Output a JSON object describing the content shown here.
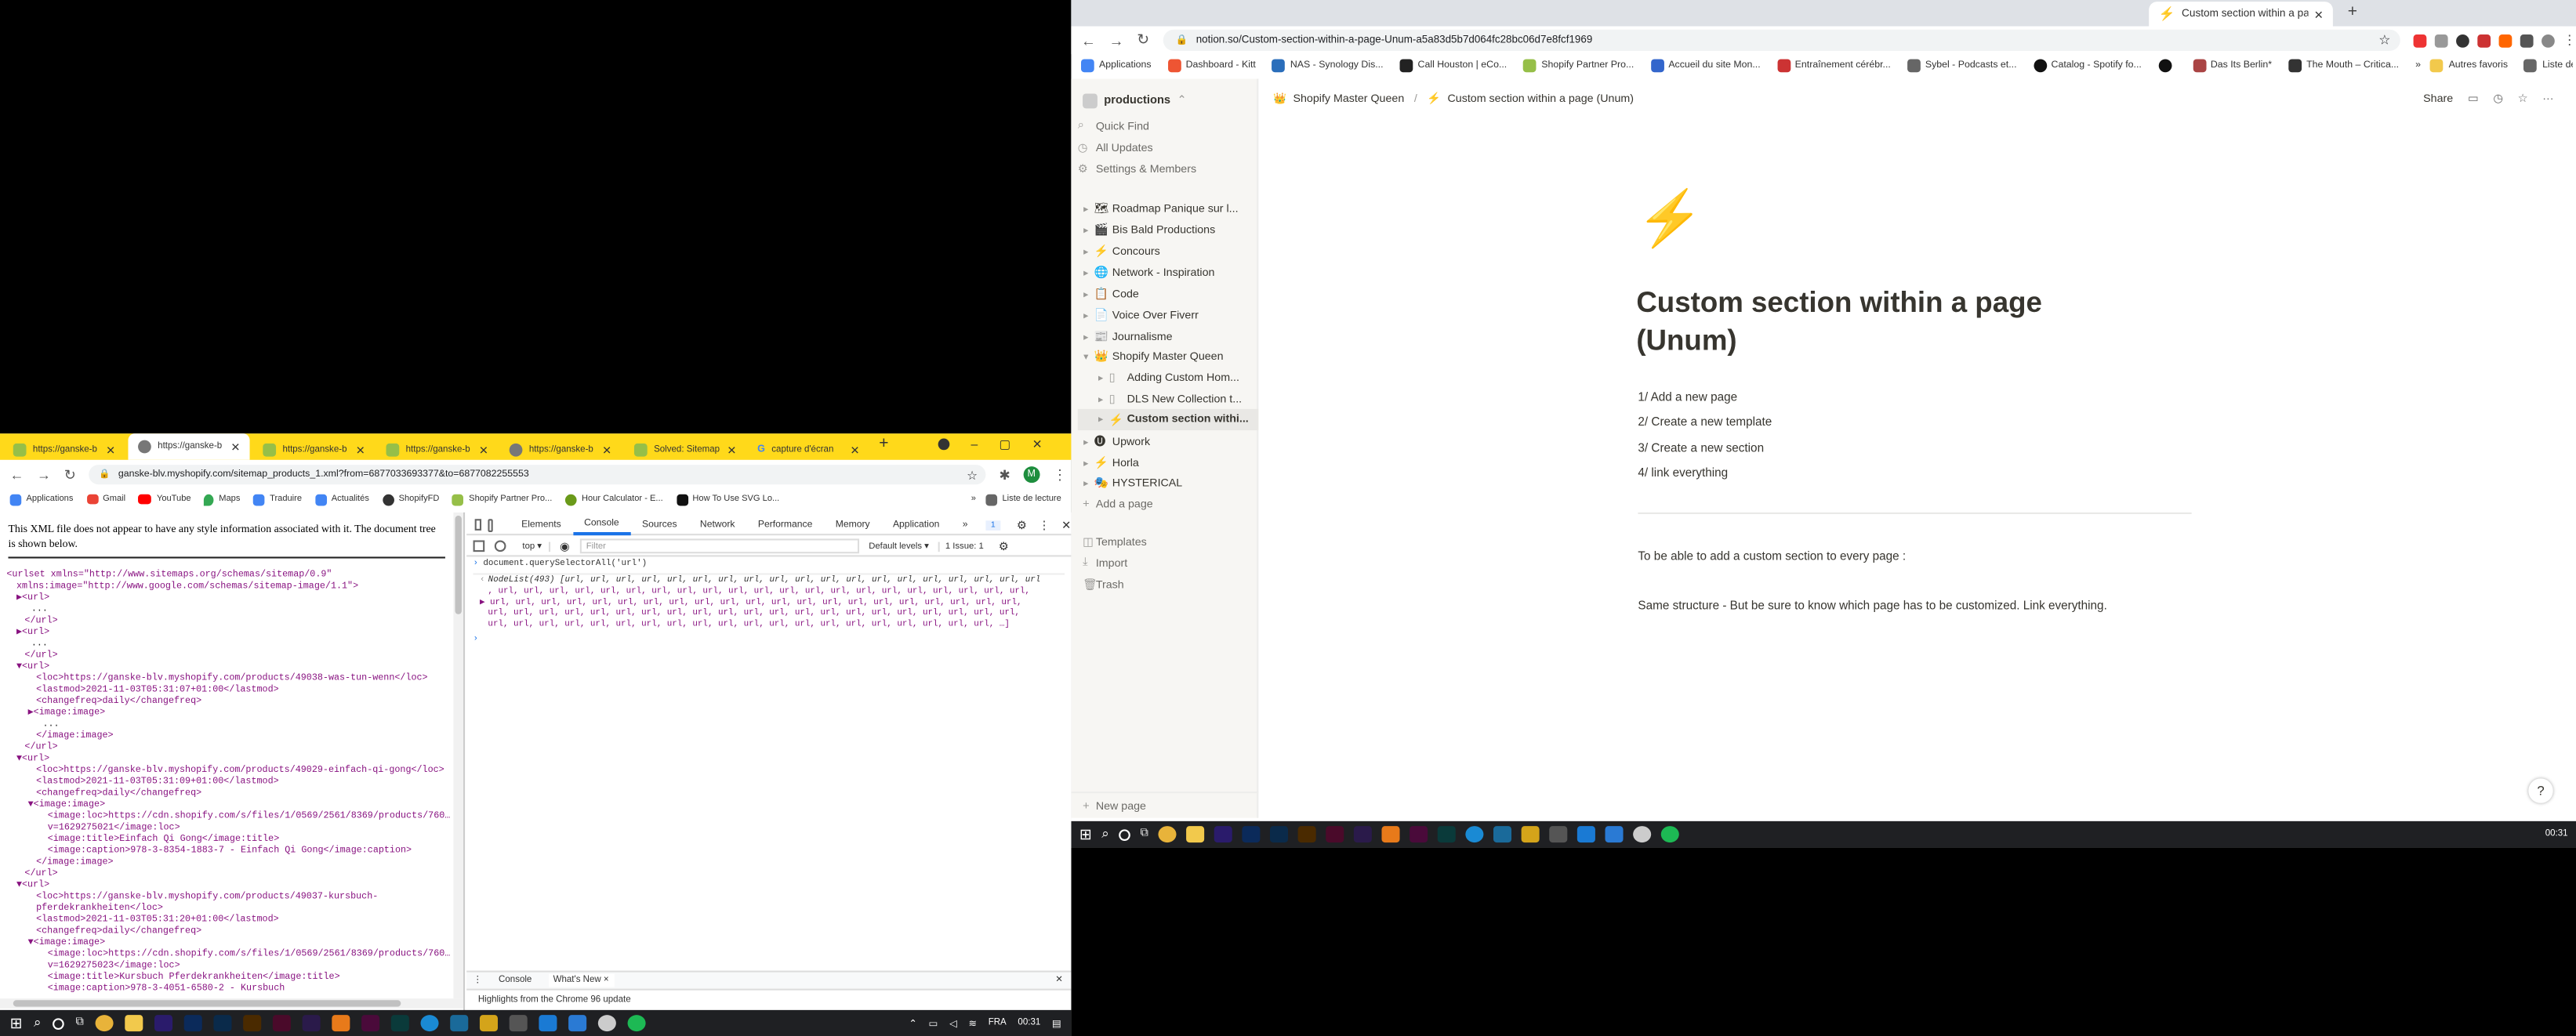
{
  "colors": {
    "notion_side": "#f7f6f3",
    "chrome_tabbar": "#dee1e6",
    "yellow_tabbar": "#ffd91a",
    "notion_text": "#37352f",
    "gray": "#9b9a97",
    "xml_tag": "#881280",
    "xml_val": "#1a1aa6",
    "devtools_accent": "#1a73e8",
    "bolt": "#f5a623"
  },
  "notion": {
    "tab_title": "Custom section within a page (U",
    "url": "notion.so/Custom-section-within-a-page-Unum-a5a83d5b7d064fc28bc06d7e8fcf1969",
    "bookmarks": [
      "Applications",
      "Dashboard - Kitt",
      "NAS - Synology Dis...",
      "Call Houston | eCo...",
      "Shopify Partner Pro...",
      "Accueil du site Mon...",
      "Entraînement cérébr...",
      "Sybel - Podcasts et...",
      "Catalog - Spotify fo...",
      "",
      "Das Its Berlin*",
      "The Mouth – Critica..."
    ],
    "bookmarks_more": "»",
    "other_bookmarks": "Autres favoris",
    "reading_list": "Liste de lecture",
    "workspace": "productions",
    "quick_find": "Quick Find",
    "all_updates": "All Updates",
    "settings": "Settings & Members",
    "pages": [
      {
        "label": "Roadmap Panique sur l...",
        "emoji": "🗺",
        "exp": "▸"
      },
      {
        "label": "Bis Bald Productions",
        "emoji": "🎬",
        "exp": "▸"
      },
      {
        "label": "Concours",
        "emoji": "⚡",
        "exp": "▸"
      },
      {
        "label": "Network - Inspiration",
        "emoji": "🌐",
        "exp": "▸"
      },
      {
        "label": "Code",
        "emoji": "📋",
        "exp": "▸"
      },
      {
        "label": "Voice Over Fiverr",
        "emoji": "📄",
        "exp": "▸"
      },
      {
        "label": "Journalisme",
        "emoji": "📰",
        "exp": "▸"
      },
      {
        "label": "Shopify Master Queen",
        "emoji": "👑",
        "exp": "▾"
      }
    ],
    "subpages": [
      {
        "label": "Adding Custom Hom...",
        "exp": "▸"
      },
      {
        "label": "DLS New Collection t...",
        "exp": "▸"
      },
      {
        "label": "Custom section withi...",
        "exp": "▸"
      }
    ],
    "pages2": [
      {
        "label": "Upwork",
        "emoji": "🅤",
        "exp": "▸"
      },
      {
        "label": "Horla",
        "emoji": "⚡",
        "exp": "▸"
      },
      {
        "label": "HYSTERICAL",
        "emoji": "🎭",
        "exp": "▸"
      }
    ],
    "add_page": "Add a page",
    "templates": "Templates",
    "import": "Import",
    "trash": "Trash",
    "new_page": "New page",
    "breadcrumb1": "Shopify Master Queen",
    "breadcrumb_sep": "/",
    "breadcrumb2": "Custom section within a page (Unum)",
    "share": "Share",
    "title_line1": "Custom section within a page",
    "title_line2": "(Unum)",
    "list": [
      "1/ Add a new page",
      "2/ Create a new template",
      "3/ Create a new section",
      "4/ link everything"
    ],
    "para1": "To be able to add a custom section to every page :",
    "para2": "Same structure - But be sure to know which page has to be customized. Link everything.",
    "help": "?",
    "clock": "00:31"
  },
  "left": {
    "tabs": [
      "https://ganske-b",
      "https://ganske-b",
      "https://ganske-b",
      "https://ganske-b",
      "https://ganske-b",
      "Solved: Sitemap",
      "capture d'écran"
    ],
    "new_tab": "+",
    "url": "ganske-blv.myshopify.com/sitemap_products_1.xml?from=6877033693377&to=6877082255553",
    "bookmarks": [
      "Applications",
      "Gmail",
      "YouTube",
      "Maps",
      "Traduire",
      "Actualités",
      "ShopifyFD",
      "Shopify Partner Pro...",
      "Hour Calculator - E...",
      "How To Use SVG Lo..."
    ],
    "bookmarks_more": "»",
    "reading_list": "Liste de lecture",
    "xml_notice": "This XML file does not appear to have any style information associated with it. The document tree is shown below.",
    "devtools_tabs": [
      "Elements",
      "Console",
      "Sources",
      "Network",
      "Performance",
      "Memory",
      "Application",
      "»"
    ],
    "context": "top ▾",
    "filter_placeholder": "Filter",
    "levels": "Default levels ▾",
    "issues": "1 Issue: 1",
    "badge": "1",
    "cmd": "document.querySelectorAll('url')",
    "nodelist_head": "NodeList(493) [url, url, url, url, url, url, url, url, url, url, url, url, url, url, url, url, url, url, url",
    "nodelist_lines": [
      ", url, url, url, url, url, url, url, url, url, url, url, url, url, url, url, url, url, url, url, url, url,",
      " url, url, url, url, url, url, url, url, url, url, url, url, url, url, url, url, url, url, url, url, url,",
      " url, url, url, url, url, url, url, url, url, url, url, url, url, url, url, url, url, url, url, url, url,",
      " url, url, url, url, url, url, url, url, url, url, url, url, url, url, url, url, url, url, url, url, …]"
    ],
    "drawer_tabs": [
      "Console",
      "What's New ×"
    ],
    "drawer_text": "Highlights from the Chrome 96 update",
    "taskbar_lang": "FRA",
    "taskbar_time": "00:31"
  },
  "xml": {
    "l1": "<urlset xmlns=\"http://www.sitemaps.org/schemas/sitemap/0.9\"",
    "l2": "xmlns:image=\"http://www.google.com/schemas/sitemap-image/1.1\">",
    "l3": "▶<url>",
    "l4": "...",
    "l5": "</url>",
    "l6": "▶<url>",
    "l7": "...",
    "l8": "</url>",
    "l9": "▼<url>",
    "l10": "<loc>https://ganske-blv.myshopify.com/products/49038-was-tun-wenn</loc>",
    "l11": "<lastmod>2021-11-03T05:31:07+01:00</lastmod>",
    "l12": "<changefreq>daily</changefreq>",
    "l13": "▶<image:image>",
    "l14": "...",
    "l15": "</image:image>",
    "l16": "</url>",
    "l17": "▼<url>",
    "l18": "<loc>https://ganske-blv.myshopify.com/products/49029-einfach-qi-gong</loc>",
    "l19": "<lastmod>2021-11-03T05:31:09+01:00</lastmod>",
    "l20": "<changefreq>daily</changefreq>",
    "l21": "▼<image:image>",
    "l22": "<image:loc>https://cdn.shopify.com/s/files/1/0569/2561/8369/products/760…",
    "l23": "v=1629275021</image:loc>",
    "l24": "<image:title>Einfach Qi Gong</image:title>",
    "l25": "<image:caption>978-3-8354-1883-7 - Einfach Qi Gong</image:caption>",
    "l26": "</image:image>",
    "l27": "</url>",
    "l28": "▼<url>",
    "l29": "<loc>https://ganske-blv.myshopify.com/products/49037-kursbuch-",
    "l30": "pferdekrankheiten</loc>",
    "l31": "<lastmod>2021-11-03T05:31:20+01:00</lastmod>",
    "l32": "<changefreq>daily</changefreq>",
    "l33": "▼<image:image>",
    "l34": "<image:loc>https://cdn.shopify.com/s/files/1/0569/2561/8369/products/760…",
    "l35": "v=1629275023</image:loc>",
    "l36": "<image:title>Kursbuch Pferdekrankheiten</image:title>",
    "l37": "<image:caption>978-3-4051-6580-2 - Kursbuch"
  }
}
